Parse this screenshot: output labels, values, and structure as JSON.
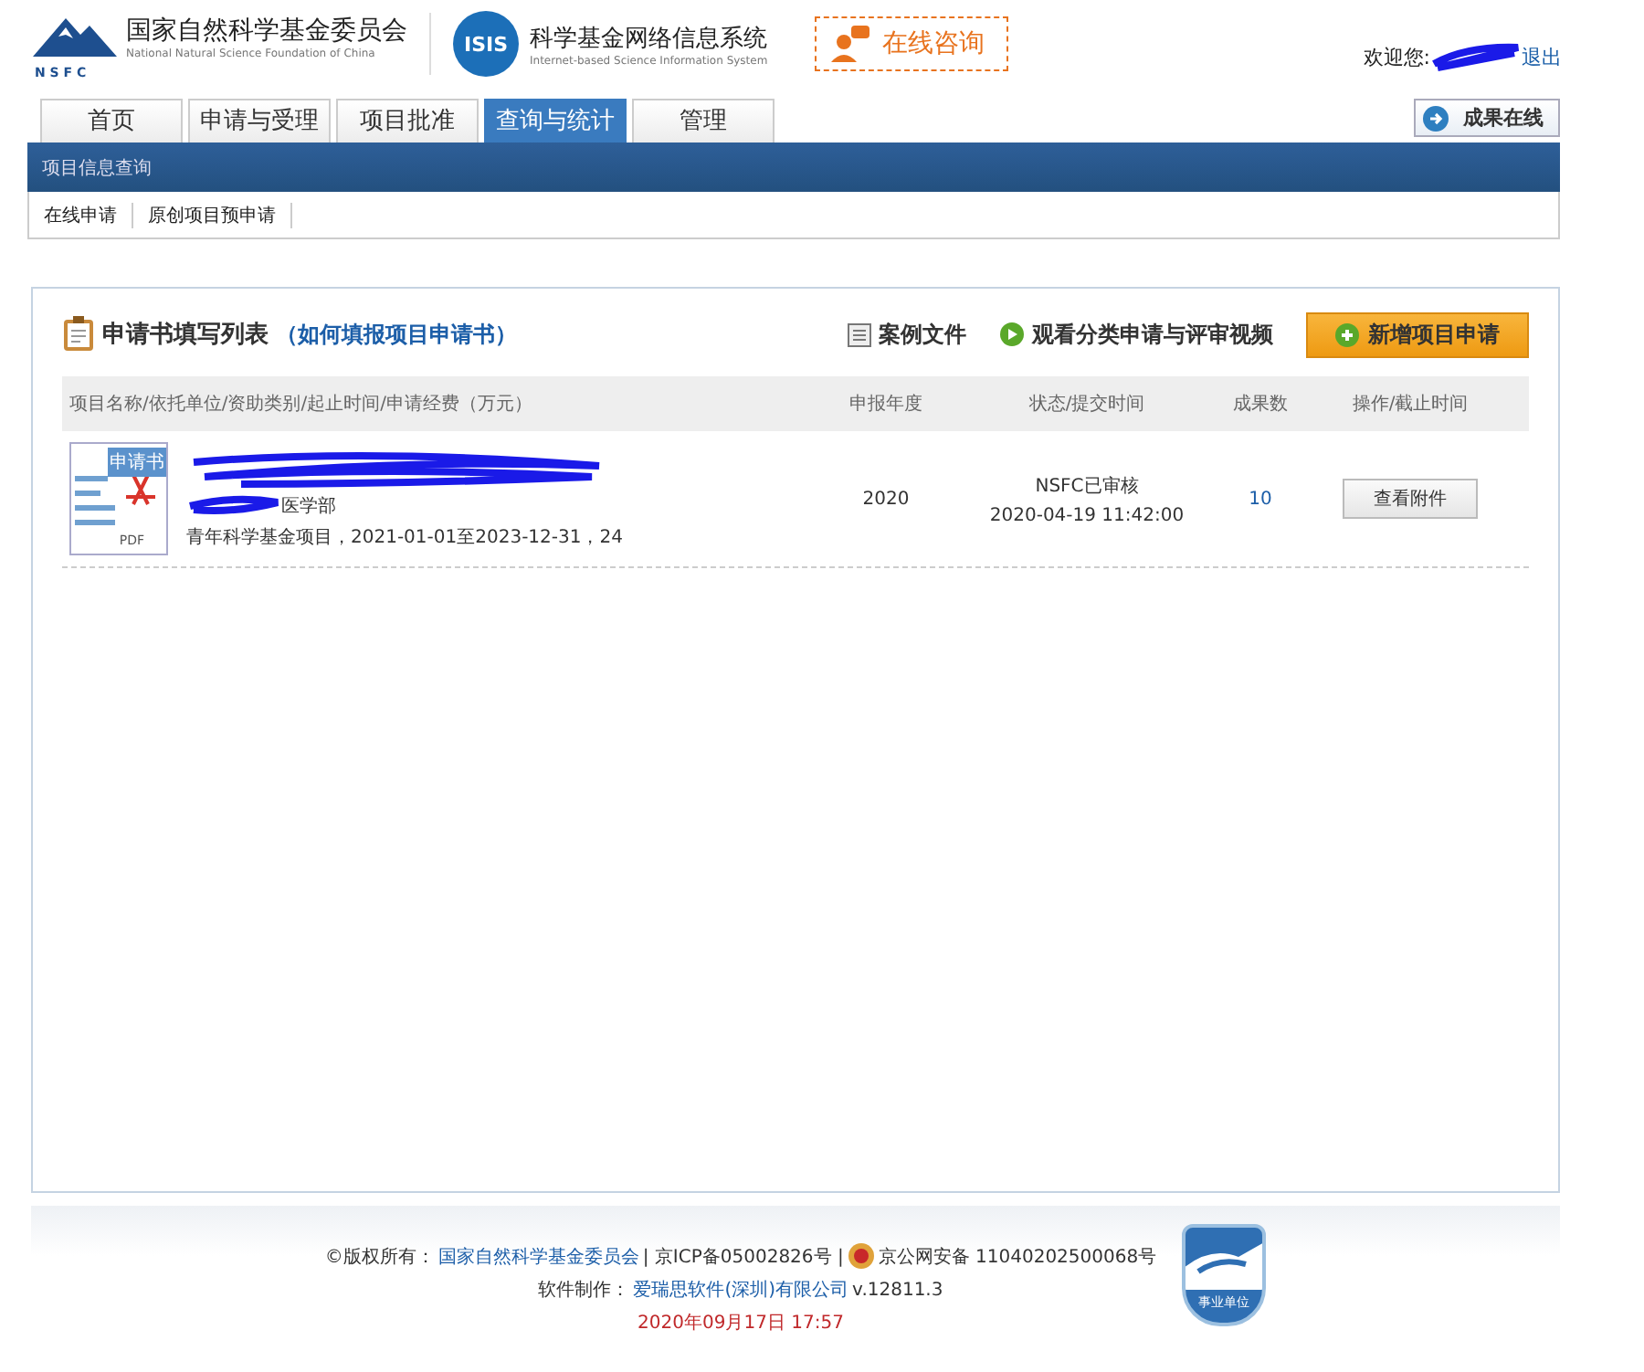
{
  "header": {
    "org_name": "国家自然科学基金委员会",
    "org_name_en": "National Natural Science Foundation of China",
    "org_logo_text": "N S F C",
    "system_logo_text": "ISIS",
    "system_name": "科学基金网络信息系统",
    "system_name_en": "Internet-based Science Information System",
    "consult_button": "在线咨询",
    "welcome": "欢迎您:",
    "logout": "退出"
  },
  "tabs": [
    {
      "label": "首页",
      "selected": false
    },
    {
      "label": "申请与受理",
      "selected": false
    },
    {
      "label": "项目批准",
      "selected": false
    },
    {
      "label": "查询与统计",
      "selected": true
    },
    {
      "label": "管理",
      "selected": false
    }
  ],
  "results_button": "成果在线",
  "subnav_title": "项目信息查询",
  "subnav_links": [
    "在线申请",
    "原创项目预申请"
  ],
  "panel": {
    "title": "申请书填写列表",
    "help_link": "（如何填报项目申请书）",
    "case_files": "案例文件",
    "video_link": "观看分类申请与评审视频",
    "new_button": "新增项目申请",
    "columns": [
      "项目名称/依托单位/资助类别/起止时间/申请经费（万元）",
      "申报年度",
      "状态/提交时间",
      "成果数",
      "操作/截止时间"
    ],
    "rows": [
      {
        "doc_label": "申请书",
        "pdf_label": "PDF",
        "unit": "医学部",
        "detail": "青年科学基金项目，2021-01-01至2023-12-31，24",
        "year": "2020",
        "status": "NSFC已审核",
        "submitted": "2020-04-19 11:42:00",
        "results": "10",
        "action": "查看附件"
      }
    ]
  },
  "footer": {
    "copyright_label": "©版权所有：",
    "copyright_org": "国家自然科学基金委员会",
    "icp": "| 京ICP备05002826号 |",
    "police": "京公网安备 11040202500068号",
    "software_label": "软件制作：",
    "software_company": "爱瑞思软件(深圳)有限公司",
    "version": "v.12811.3",
    "datetime": "2020年09月17日 17:57",
    "badge": "事业单位"
  }
}
